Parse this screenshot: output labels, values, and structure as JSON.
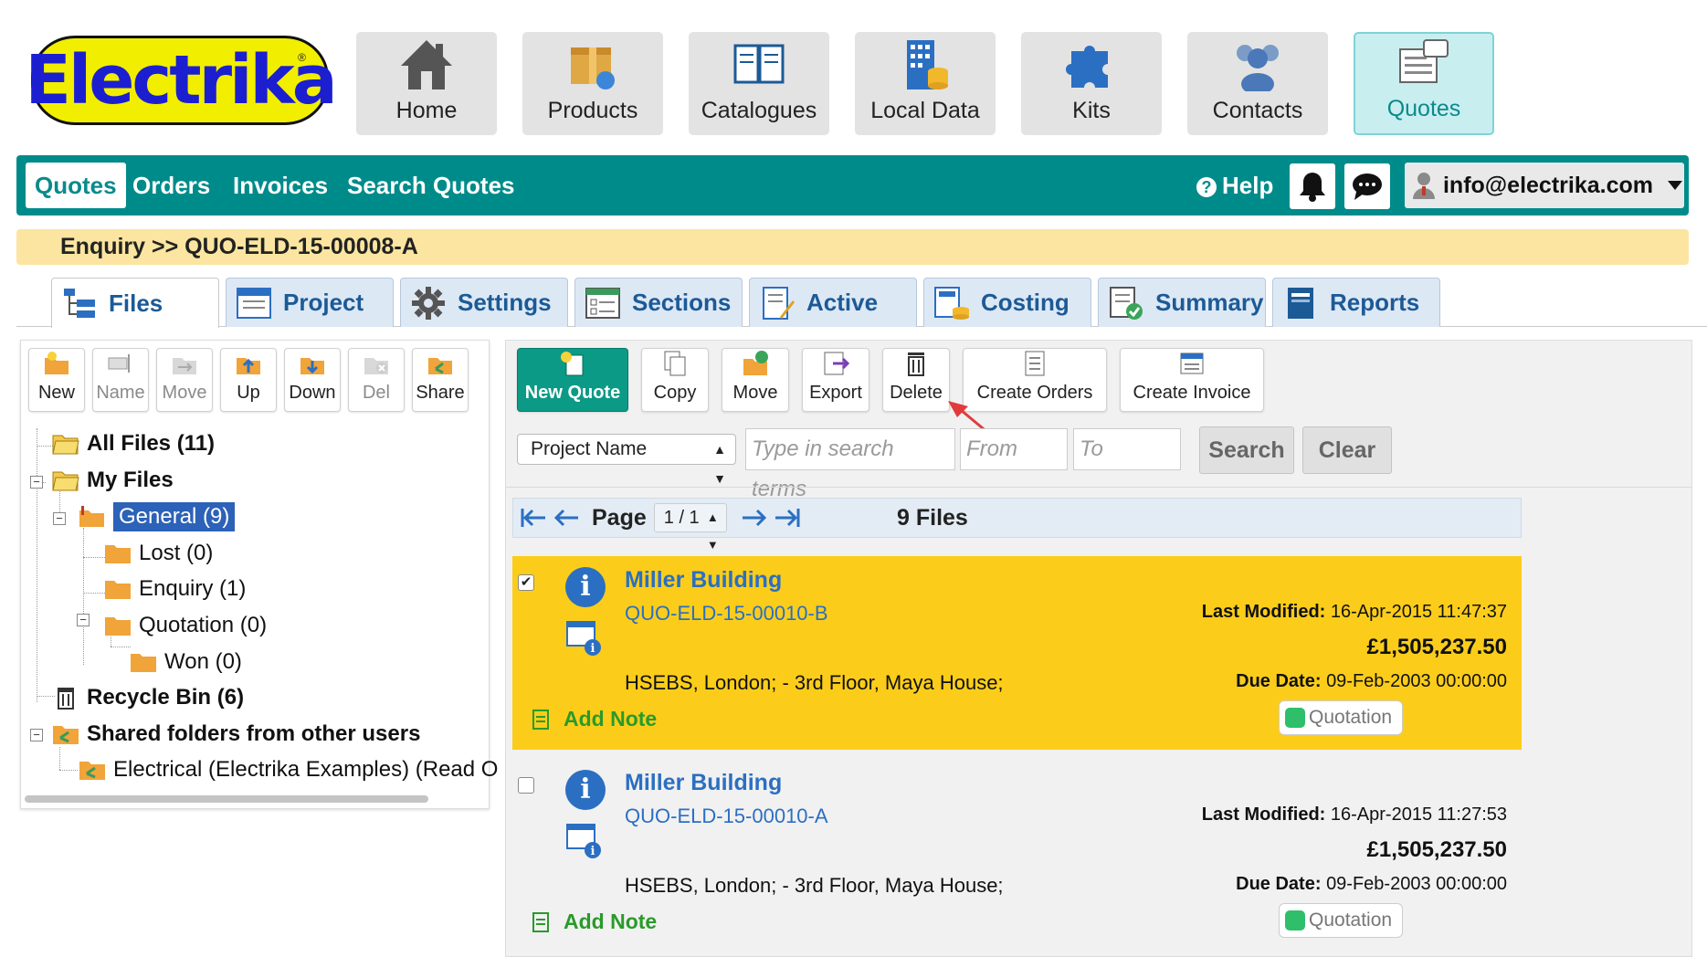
{
  "brand": {
    "logo_text": "Electrika"
  },
  "app_nav": [
    {
      "label": "Home",
      "icon": "home-icon"
    },
    {
      "label": "Products",
      "icon": "products-box-icon"
    },
    {
      "label": "Catalogues",
      "icon": "book-icon"
    },
    {
      "label": "Local Data",
      "icon": "database-building-icon"
    },
    {
      "label": "Kits",
      "icon": "puzzle-icon"
    },
    {
      "label": "Contacts",
      "icon": "people-icon"
    },
    {
      "label": "Quotes",
      "icon": "quote-document-icon",
      "active": true
    }
  ],
  "nav": {
    "links": [
      "Quotes",
      "Orders",
      "Invoices",
      "Search Quotes"
    ],
    "help": "Help",
    "user_email": "info@electrika.com"
  },
  "breadcrumb": "Enquiry >> QUO-ELD-15-00008-A",
  "tabs": [
    "Files",
    "Project",
    "Settings",
    "Sections",
    "Active",
    "Costing",
    "Summary",
    "Reports"
  ],
  "left_toolbar": [
    "New",
    "Name",
    "Move",
    "Up",
    "Down",
    "Del",
    "Share"
  ],
  "tree": {
    "all_files": "All Files (11)",
    "my_files": "My Files",
    "general": "General (9)",
    "lost": "Lost (0)",
    "enquiry": "Enquiry (1)",
    "quotation": "Quotation (0)",
    "won": "Won (0)",
    "recycle": "Recycle Bin (6)",
    "shared": "Shared folders from other users",
    "electrical": "Electrical (Electrika Examples) (Read O"
  },
  "right_toolbar": [
    "New Quote",
    "Copy",
    "Move",
    "Export",
    "Delete",
    "Create Orders",
    "Create Invoice"
  ],
  "search": {
    "field_select": "Project Name",
    "terms_placeholder": "Type in search terms",
    "from_placeholder": "From",
    "to_placeholder": "To",
    "search_label": "Search",
    "clear_label": "Clear"
  },
  "pager": {
    "label": "Page",
    "page": "1 / 1",
    "count": "9 Files"
  },
  "quotes": [
    {
      "title": "Miller Building",
      "number": "QUO-ELD-15-00010-B",
      "address": "HSEBS, London; - 3rd Floor, Maya House;",
      "last_modified_label": "Last Modified:",
      "last_modified": "16-Apr-2015 11:47:37",
      "price": "£1,505,237.50",
      "due_label": "Due Date:",
      "due": "09-Feb-2003 00:00:00",
      "status": "Quotation",
      "note": "Add Note",
      "checked": true
    },
    {
      "title": "Miller Building",
      "number": "QUO-ELD-15-00010-A",
      "address": "HSEBS, London; - 3rd Floor, Maya House;",
      "last_modified_label": "Last Modified:",
      "last_modified": "16-Apr-2015 11:27:53",
      "price": "£1,505,237.50",
      "due_label": "Due Date:",
      "due": "09-Feb-2003 00:00:00",
      "status": "Quotation",
      "note": "Add Note",
      "checked": false
    }
  ],
  "colors": {
    "teal": "#008b8b",
    "selected_row": "#fbcd1a",
    "link_blue": "#2b6fc2",
    "note_green": "#2a9a2a"
  }
}
